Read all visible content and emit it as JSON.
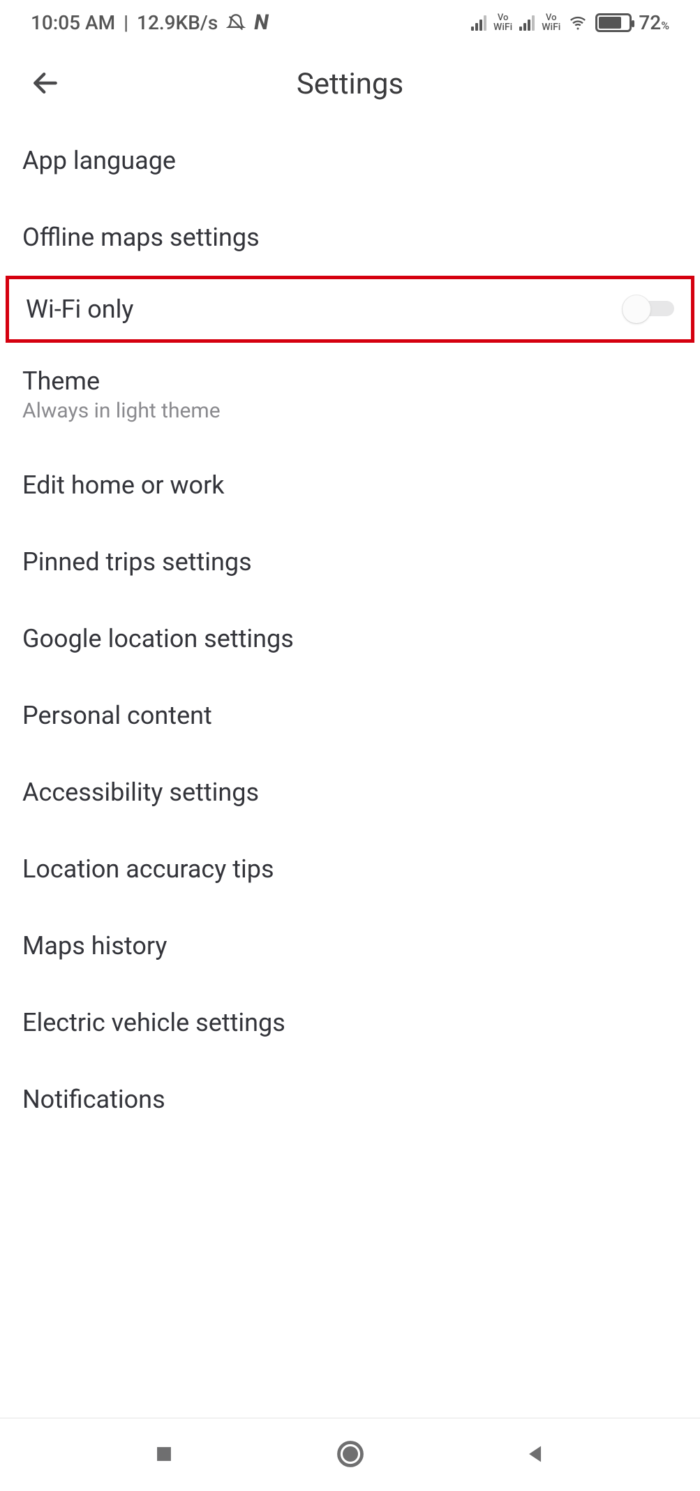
{
  "status": {
    "time": "10:05 AM",
    "net_speed": "12.9KB/s",
    "battery_pct": "72",
    "vo_label": "Vo",
    "wifi_label": "WiFi"
  },
  "header": {
    "title": "Settings"
  },
  "items": {
    "app_language": "App language",
    "offline_maps": "Offline maps settings",
    "wifi_only": "Wi-Fi only",
    "theme_title": "Theme",
    "theme_sub": "Always in light theme",
    "edit_home_work": "Edit home or work",
    "pinned_trips": "Pinned trips settings",
    "google_location": "Google location settings",
    "personal_content": "Personal content",
    "accessibility": "Accessibility settings",
    "location_accuracy": "Location accuracy tips",
    "maps_history": "Maps history",
    "ev_settings": "Electric vehicle settings",
    "notifications": "Notifications"
  },
  "toggles": {
    "wifi_only_on": false
  },
  "highlight": "wifi_only"
}
